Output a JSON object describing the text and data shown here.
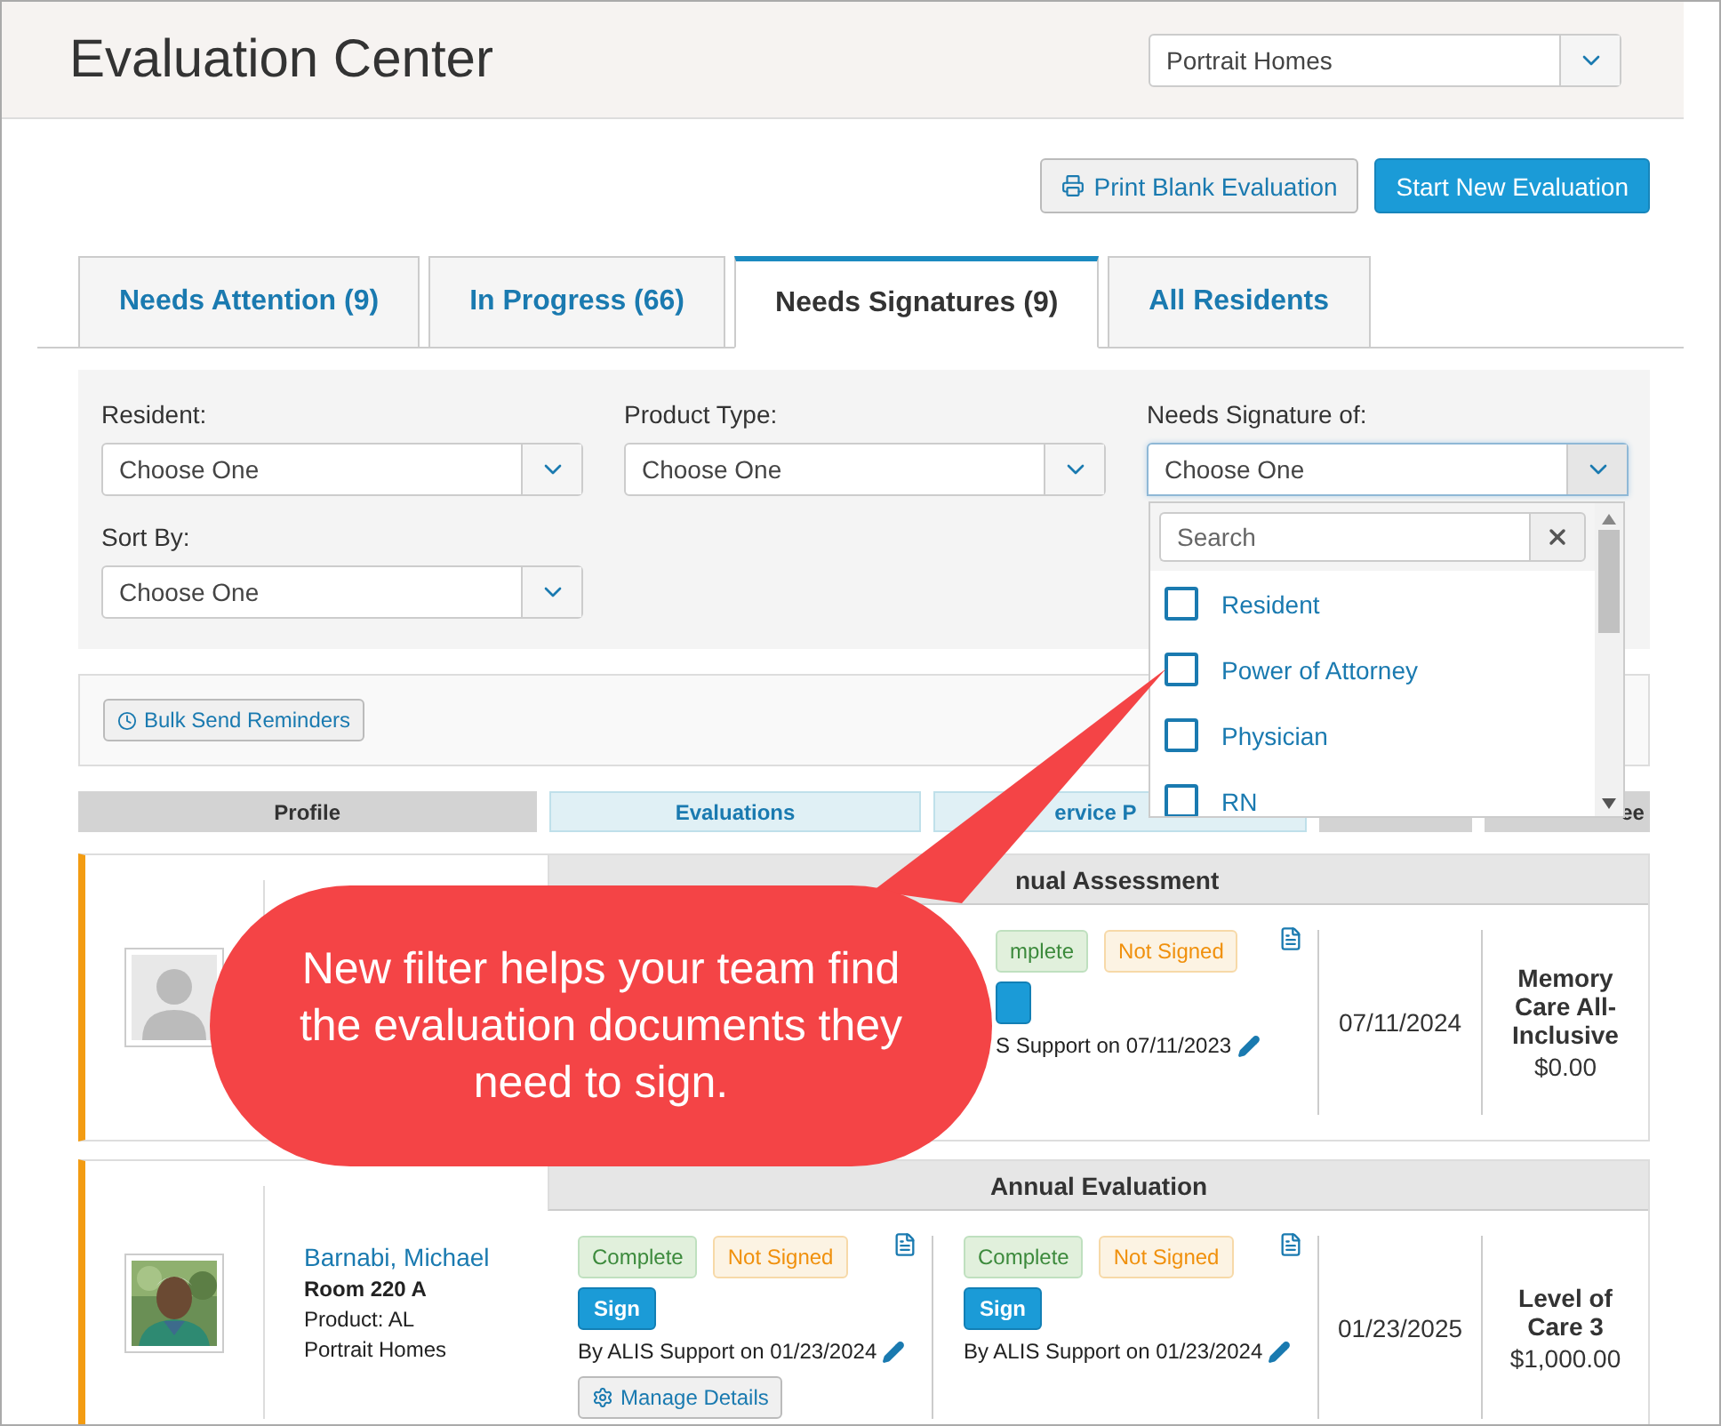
{
  "header": {
    "title": "Evaluation Center",
    "community_select": {
      "value": "Portrait Homes"
    }
  },
  "actions": [
    {
      "label": "Print Blank Evaluation",
      "kind": "secondary"
    },
    {
      "label": "Start New Evaluation",
      "kind": "primary"
    }
  ],
  "tabs": [
    {
      "label": "Needs Attention (9)",
      "selected": false
    },
    {
      "label": "In Progress (66)",
      "selected": false
    },
    {
      "label": "Needs Signatures (9)",
      "selected": true
    },
    {
      "label": "All Residents",
      "selected": false
    }
  ],
  "filters": [
    {
      "label": "Resident:",
      "value": "Choose One",
      "expanded": false
    },
    {
      "label": "Product Type:",
      "value": "Choose One",
      "expanded": false
    },
    {
      "label": "Needs Signature of:",
      "value": "Choose One",
      "expanded": true
    },
    {
      "label": "Sort By:",
      "value": "Choose One",
      "expanded": false
    }
  ],
  "signature_dropdown": {
    "placeholder": "Search",
    "options": [
      {
        "label": "Resident",
        "checked": false
      },
      {
        "label": "Power of Attorney",
        "checked": false
      },
      {
        "label": "Physician",
        "checked": false
      },
      {
        "label": "RN",
        "checked": false
      }
    ]
  },
  "bulk_button": {
    "label": "Bulk Send Reminders"
  },
  "columns": [
    {
      "label": "Profile",
      "kind": "gray"
    },
    {
      "label": "Evaluations",
      "kind": "blue"
    },
    {
      "label": "ervice P",
      "kind": "blue"
    },
    {
      "kind": "gray"
    },
    {
      "label": "ee",
      "kind": "gray"
    }
  ],
  "rows": [
    {
      "kind": "placeholder",
      "header": "nual Assessment",
      "evaluations": [
        {
          "kind": "covered"
        },
        {
          "kind": "shown",
          "status": "mplete",
          "signature": "Not Signed",
          "sign_button": true,
          "signed_by": "S Support on 07/11/2023"
        }
      ],
      "date": "07/11/2024",
      "care_level": "Memory Care All-Inclusive",
      "price": "$0.00"
    },
    {
      "name": "Barnabi, Michael",
      "room": "Room 220 A",
      "product": "Product: AL",
      "community": "Portrait Homes",
      "header": "Annual Evaluation",
      "evaluations": [
        {
          "kind": "shown",
          "status": "Complete",
          "signature": "Not Signed",
          "sign_button": true,
          "sign_label": "Sign",
          "signed_by": "By ALIS Support on 01/23/2024",
          "manage": "Manage Details"
        },
        {
          "kind": "shown",
          "status": "Complete",
          "signature": "Not Signed",
          "sign_button": true,
          "sign_label": "Sign",
          "signed_by": "By ALIS Support on 01/23/2024"
        }
      ],
      "date": "01/23/2025",
      "care_level": "Level of Care 3",
      "price": "$1,000.00"
    }
  ],
  "callout": {
    "text": "New filter helps your team find the evaluation documents they need to sign."
  }
}
